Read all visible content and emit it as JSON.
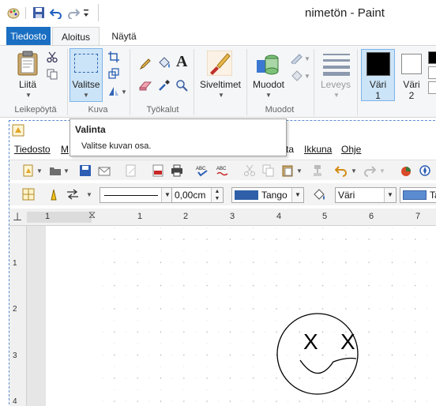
{
  "window": {
    "title": "nimetön - Paint"
  },
  "ribbon_tabs": {
    "file": "Tiedosto",
    "home": "Aloitus",
    "view": "Näytä"
  },
  "clipboard": {
    "paste": "Liitä",
    "group": "Leikepöytä"
  },
  "image": {
    "select": "Valitse",
    "group": "Kuva"
  },
  "tools": {
    "group": "Työkalut"
  },
  "brushes": {
    "label": "Siveltimet"
  },
  "shapes": {
    "label": "Muodot",
    "group": "Muodot"
  },
  "size": {
    "label": "Leveys"
  },
  "colors": {
    "color1_a": "Väri",
    "color1_b": "1",
    "color2_a": "Väri",
    "color2_b": "2"
  },
  "tooltip": {
    "title": "Valinta",
    "body": "Valitse kuvan osa."
  },
  "inner_menu": {
    "file": "Tiedosto",
    "m": "M",
    "partial_ta": "ta",
    "window": "Ikkuna",
    "help": "Ohje"
  },
  "inner_toolbar2": {
    "line_width": "0,00cm",
    "area_style": "Tango",
    "fill_type": "Väri",
    "partial_ta": "Ta"
  },
  "ruler": {
    "labels": [
      "1",
      "1",
      "2",
      "3",
      "4",
      "5",
      "6",
      "7"
    ],
    "v_labels": [
      "1",
      "2",
      "3",
      "4"
    ]
  },
  "drawing": {
    "eye_left": "X",
    "eye_right": "X"
  },
  "accent_colors": {
    "file_tab": "#1a6fc2",
    "selection": "#5b8bd0",
    "line_swatch": "#2e5fa8"
  }
}
